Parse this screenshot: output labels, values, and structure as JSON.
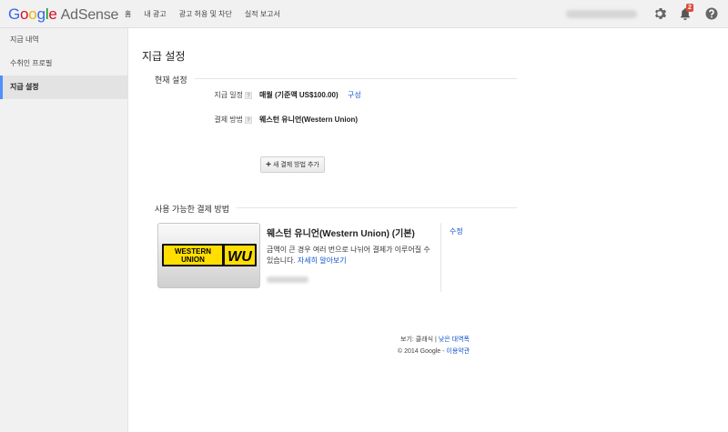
{
  "header": {
    "logo_letters": [
      "G",
      "o",
      "o",
      "g",
      "l",
      "e"
    ],
    "brand": "AdSense",
    "nav": [
      "홈",
      "내 광고",
      "광고 허용 및 차단",
      "실적 보고서"
    ],
    "notification_count": "2",
    "icons": [
      "gear-icon",
      "bell-icon",
      "help-icon"
    ]
  },
  "sidebar": {
    "items": [
      {
        "label": "지급 내역"
      },
      {
        "label": "수취인 프로필"
      },
      {
        "label": "지급 설정"
      }
    ],
    "active_index": 2
  },
  "main": {
    "title": "지급 설정",
    "current": {
      "heading": "현재 설정",
      "schedule_label": "지급 일정",
      "schedule_value": "매월 (기준액 US$100.00)",
      "schedule_link": "구성",
      "method_label": "결제 방법",
      "method_value": "웨스턴 유니언(Western Union)",
      "help_glyph": "?",
      "add_button_icon": "+",
      "add_button": "새 결제 방법 추가"
    },
    "available": {
      "heading": "사용 가능한 결제 방법",
      "logo_text": [
        "WESTERN",
        "UNION",
        "WU"
      ],
      "method_title": "웨스턴 유니언(Western Union) (기본)",
      "description": "금액이 큰 경우 여러 번으로 나뉘어 결제가 이루어질 수 있습니다.",
      "learn_more": "자세히 알아보기",
      "edit": "수정"
    }
  },
  "footer": {
    "view_prefix": "보기: 클래식",
    "separator": "|",
    "view_link": "낮은 대역폭",
    "copyright": "© 2014 Google -",
    "terms": "이용약관"
  },
  "colors": {
    "accent": "#1155cc",
    "wu_yellow": "#ffde00",
    "badge": "#dd4b39"
  }
}
